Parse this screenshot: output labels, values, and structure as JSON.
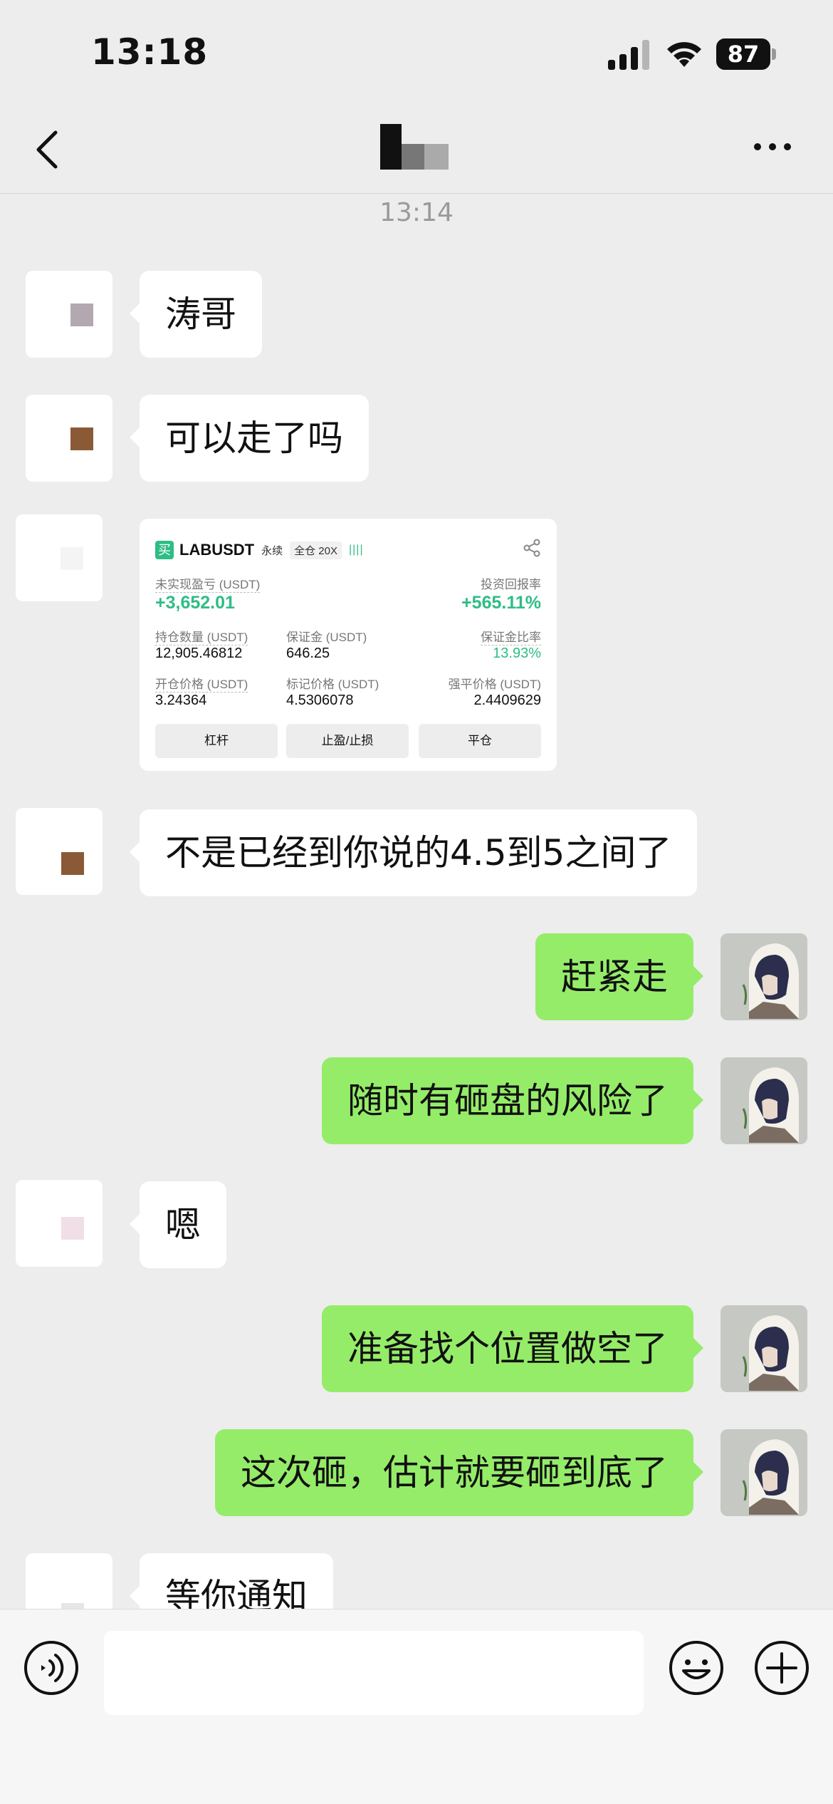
{
  "status": {
    "time": "13:18",
    "battery": "87"
  },
  "nav": {
    "back_icon": "chevron-left-icon",
    "more_icon": "more-dots-icon"
  },
  "timestamp": "13:14",
  "messages": [
    {
      "side": "left",
      "text": "涛哥"
    },
    {
      "side": "left",
      "text": "可以走了吗"
    },
    {
      "side": "left",
      "type": "image"
    },
    {
      "side": "left",
      "text": "不是已经到你说的4.5到5之间了"
    },
    {
      "side": "right",
      "text": "赶紧走"
    },
    {
      "side": "right",
      "text": "随时有砸盘的风险了"
    },
    {
      "side": "left",
      "text": "嗯"
    },
    {
      "side": "right",
      "text": "准备找个位置做空了"
    },
    {
      "side": "right",
      "text": "这次砸，估计就要砸到底了"
    },
    {
      "side": "left",
      "text": "等你通知"
    }
  ],
  "trade_card": {
    "buy_badge": "买",
    "symbol": "LABUSDT",
    "tag_perpetual": "永续",
    "tag_margin": "全仓 20X",
    "leverage_bars": "||||",
    "unrealized_pnl_label": "未实现盈亏 (USDT)",
    "unrealized_pnl_value": "+3,652.01",
    "roi_label": "投资回报率",
    "roi_value": "+565.11%",
    "position_size_label": "持仓数量 (USDT)",
    "position_size_value": "12,905.46812",
    "margin_label": "保证金 (USDT)",
    "margin_value": "646.25",
    "margin_ratio_label": "保证金比率",
    "margin_ratio_value": "13.93%",
    "entry_price_label": "开仓价格 (USDT)",
    "entry_price_value": "3.24364",
    "mark_price_label": "标记价格 (USDT)",
    "mark_price_value": "4.5306078",
    "liq_price_label": "强平价格 (USDT)",
    "liq_price_value": "2.4409629",
    "btn_leverage": "杠杆",
    "btn_tpsl": "止盈/止损",
    "btn_close": "平仓"
  },
  "input": {
    "placeholder": ""
  },
  "colors": {
    "background": "#ededed",
    "bubble_self": "#95ec69",
    "bubble_other": "#ffffff",
    "profit_green": "#2ebd85"
  }
}
